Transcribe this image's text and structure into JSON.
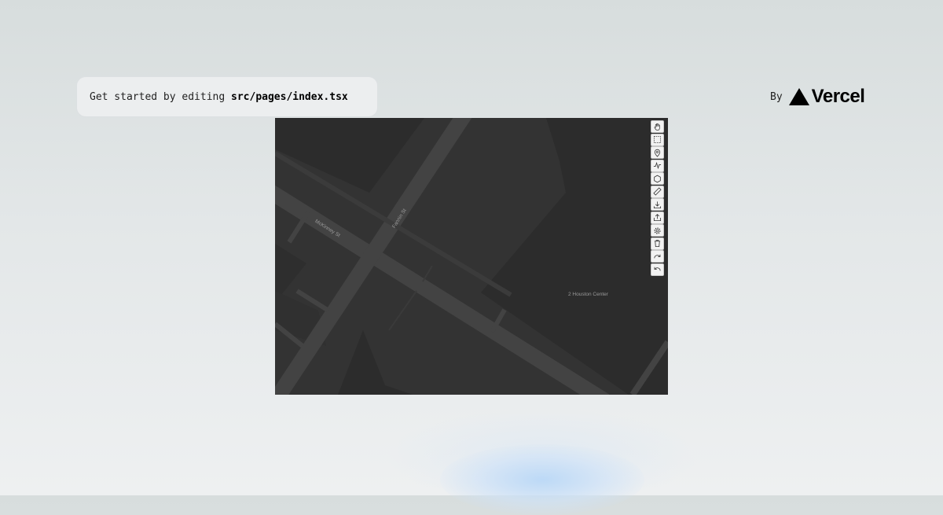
{
  "header": {
    "description_prefix": "Get started by editing",
    "description_file": "src/pages/index.tsx",
    "by_label": "By",
    "brand_name": "Vercel"
  },
  "map": {
    "labels": {
      "street_1": "McKinney St",
      "street_2": "Fannin St",
      "building": "2 Houston Center"
    },
    "toolbar": [
      {
        "name": "pan-tool",
        "icon": "hand-icon"
      },
      {
        "name": "select-box-tool",
        "icon": "dashed-rectangle-icon"
      },
      {
        "name": "point-tool",
        "icon": "map-pin-icon"
      },
      {
        "name": "line-tool",
        "icon": "polyline-icon"
      },
      {
        "name": "polygon-tool",
        "icon": "hexagon-icon"
      },
      {
        "name": "measure-tool",
        "icon": "ruler-icon"
      },
      {
        "name": "import-tool",
        "icon": "download-icon"
      },
      {
        "name": "export-tool",
        "icon": "upload-icon"
      },
      {
        "name": "settings-tool",
        "icon": "gear-icon"
      },
      {
        "name": "delete-tool",
        "icon": "trash-icon"
      },
      {
        "name": "redo-tool",
        "icon": "redo-icon"
      },
      {
        "name": "undo-tool",
        "icon": "undo-icon"
      }
    ]
  },
  "colors": {
    "map_background": "#333333",
    "map_block": "#2c2c2c",
    "map_road": "#434343"
  }
}
